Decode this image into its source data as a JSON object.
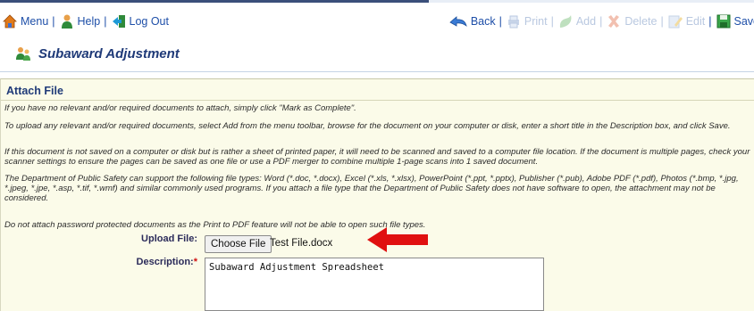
{
  "toolbar": {
    "menu_label": "Menu",
    "help_label": "Help",
    "logout_label": "Log Out",
    "back_label": "Back",
    "print_label": "Print",
    "add_label": "Add",
    "delete_label": "Delete",
    "edit_label": "Edit",
    "save_label": "Save",
    "separator": "|"
  },
  "page": {
    "title": "Subaward Adjustment"
  },
  "panel": {
    "title": "Attach File",
    "instructions": [
      "If you have no relevant and/or required documents to attach, simply click \"Mark as Complete\".",
      "To upload any relevant and/or required documents, select Add from the menu toolbar, browse for the document on your computer or disk, enter a short title in the Description box, and click Save.",
      "If this document is not saved on a computer or disk but is rather a sheet of printed paper, it will need to be scanned and saved to a computer file location. If the document is multiple pages, check your scanner settings to ensure the pages can be saved as one file or use a PDF merger to combine multiple 1-page scans into 1 saved document.",
      "The Department of Public Safety can support the following file types: Word (*.doc, *.docx), Excel (*.xls, *.xlsx), PowerPoint (*.ppt, *.pptx), Publisher (*.pub), Adobe PDF (*.pdf), Photos (*.bmp, *.jpg, *.jpeg, *.jpe, *.asp, *.tif, *.wmf) and similar commonly used programs. If you attach a file type that the Department of Public Safety does not have software to open, the attachment may not be considered.",
      "Do not attach password protected documents as the Print to PDF feature will not be able to open such file types."
    ],
    "upload_label": "Upload File:",
    "choose_file_label": "Choose File",
    "file_name": "Test File.docx",
    "description_label": "Description:",
    "required_marker": "*",
    "description_value": "Subaward Adjustment Spreadsheet"
  },
  "colors": {
    "link": "#1e4fa8",
    "panel_bg": "#fbfbe9",
    "heading": "#1f3a78",
    "arrow": "#e01010"
  }
}
